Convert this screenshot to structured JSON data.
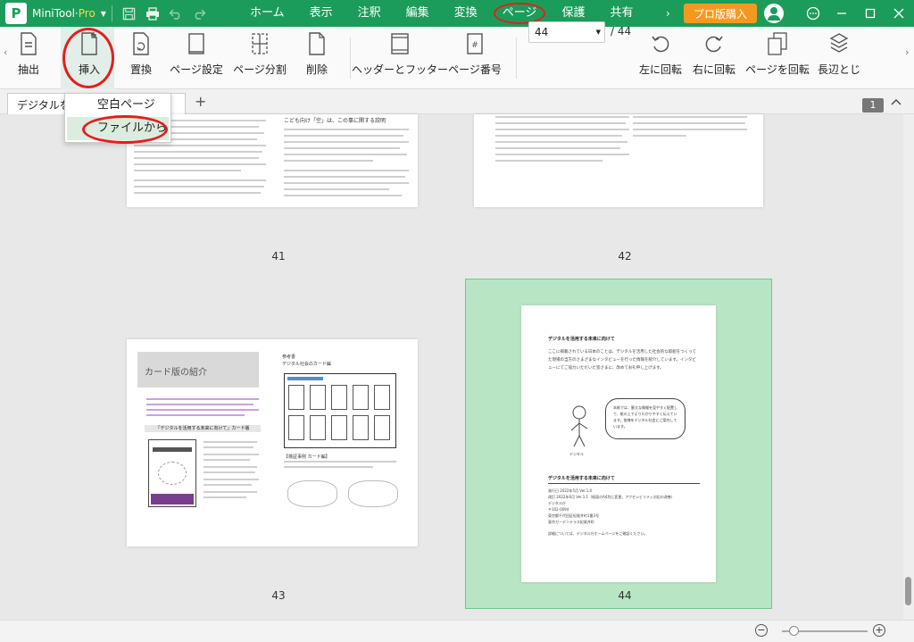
{
  "app": {
    "name_prefix": "MiniTool·",
    "name_suffix": "Pro",
    "logo_letter": "P"
  },
  "menu": {
    "items": [
      "ホーム",
      "表示",
      "注釈",
      "編集",
      "変換",
      "ページ",
      "保護",
      "共有"
    ],
    "active": "ページ",
    "buy_label": "プロ版購入"
  },
  "ribbon": {
    "items": [
      {
        "label": "抽出",
        "icon": "extract-icon"
      },
      {
        "label": "挿入",
        "icon": "insert-icon"
      },
      {
        "label": "置換",
        "icon": "replace-icon"
      },
      {
        "label": "ページ設定",
        "icon": "page-setup-icon"
      },
      {
        "label": "ページ分割",
        "icon": "split-page-icon"
      },
      {
        "label": "削除",
        "icon": "delete-icon"
      },
      {
        "label": "ヘッダーとフッター",
        "icon": "header-footer-icon"
      },
      {
        "label": "ページ番号",
        "icon": "page-number-icon"
      },
      {
        "label": "左に回転",
        "icon": "rotate-left-icon"
      },
      {
        "label": "右に回転",
        "icon": "rotate-right-icon"
      },
      {
        "label": "ページを回転",
        "icon": "rotate-page-icon"
      },
      {
        "label": "長辺とじ",
        "icon": "long-edge-binding-icon"
      }
    ],
    "page_input": "44",
    "page_total": "/ 44"
  },
  "insert_menu": {
    "items": [
      "空白ページ",
      "ファイルから"
    ],
    "hovered": "ファイルから"
  },
  "tabs": {
    "doc_title": "デジタルを",
    "page_badge": "1"
  },
  "pages": {
    "numbers": [
      "41",
      "42",
      "43",
      "44"
    ],
    "selected": "44",
    "p41_heading": "こども向け「空」は、この事に関する説明",
    "p43_title": "カード版の紹介",
    "p43_section": "「デジタルを活用する未来に向けて」カード版",
    "p43_label": "参考書",
    "p43_sub": "デジタル社会のカード編",
    "p43_sub2": "【検証事例 カード編】",
    "p44_heading": "デジタルを活用する未来に向けて",
    "p44_para": "ここに掲載されている日本のことは、デジタルを活用した社会的な取組をつくってた現場の当方のさまざまなインタビューを行った情報を紹介しています。インタビューにてご協力いただいた皆さまに、改めてお礼申し上げます。",
    "p44_bubble": "本紙では、膨大な情報を見やすく配置して、紙の上でよりわかりやすく伝えています。皆様をデジタル社会にご案内しています。",
    "p44_caption": "デジタル",
    "p44_heading2": "デジタルを活用する未来に向けて",
    "p44_colophon": [
      "発行日 2022年5月 Ver.1.0",
      "改訂 2022年6月 Ver.1.1（紙面のA4判に変更。アクセシビリティ対応の改善）",
      "デジタル庁",
      "〒102-0094",
      "東京都千代田区紀尾井町1番3号",
      "東京ガーデンテラス紀尾井町",
      "",
      "詳細については、デジタル庁ホームページをご確認ください。"
    ]
  },
  "colors": {
    "brand": "#1c9c5a",
    "buy": "#f39a1e",
    "highlight": "#e02020",
    "selected_bg": "#b8e6c4"
  }
}
